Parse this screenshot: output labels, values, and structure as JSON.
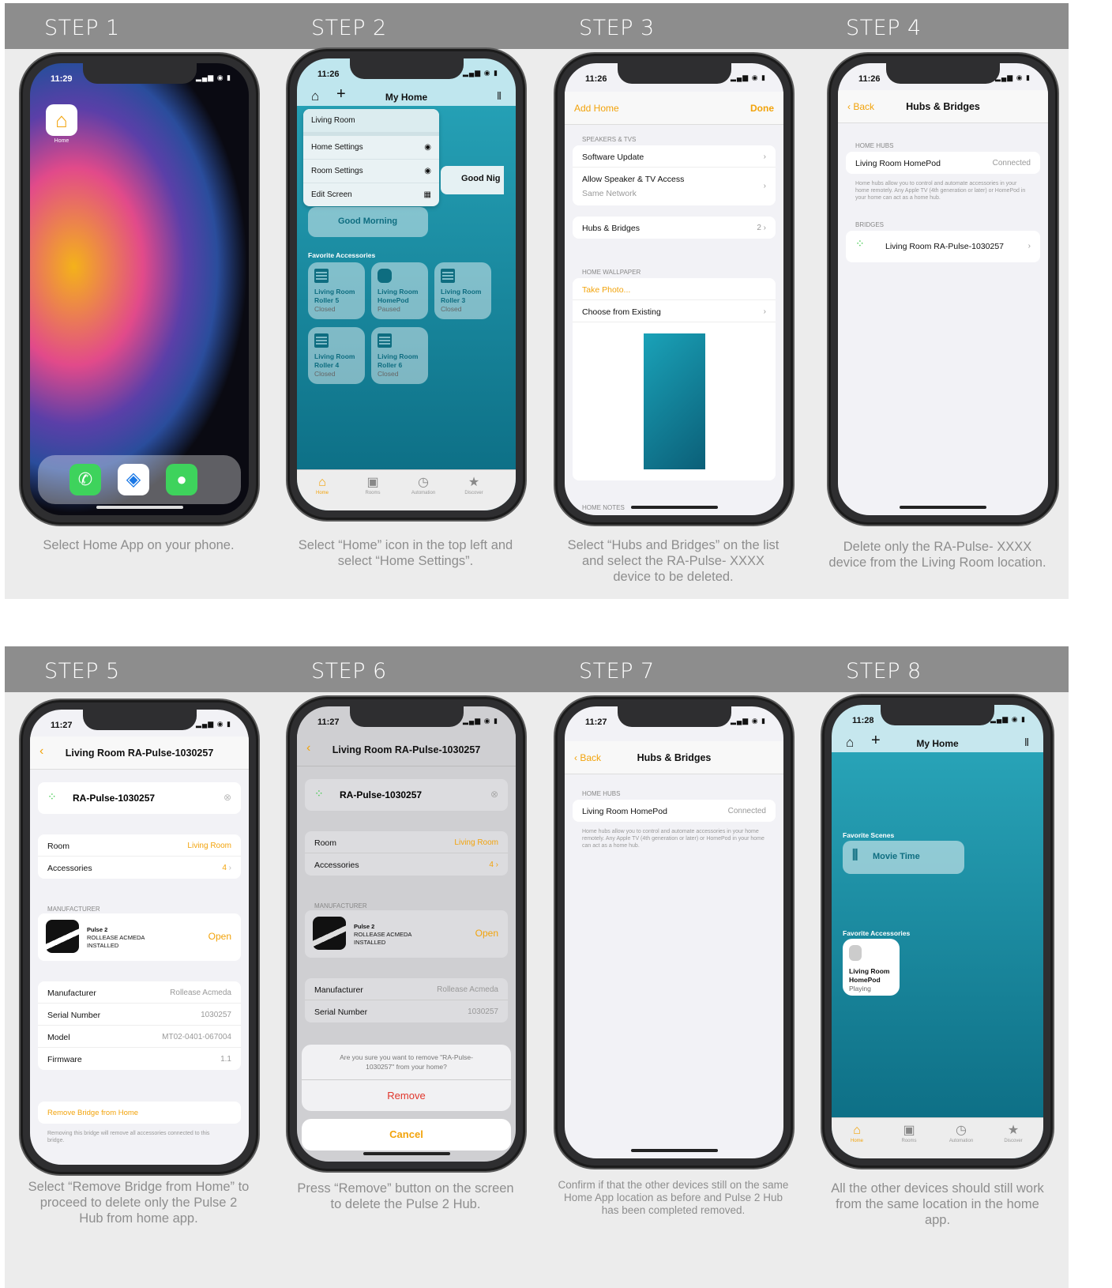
{
  "steps": [
    {
      "title": "STEP 1",
      "caption": "Select Home App on your phone."
    },
    {
      "title": "STEP 2",
      "caption": "Select “Home” icon in the top left and select “Home Settings”."
    },
    {
      "title": "STEP 3",
      "caption": "Select “Hubs and Bridges” on the list and select the RA-Pulse- XXXX device to be deleted."
    },
    {
      "title": "STEP 4",
      "caption": "Delete only the RA-Pulse- XXXX device from the Living Room location."
    },
    {
      "title": "STEP 5",
      "caption": "Select “Remove Bridge from Home” to proceed to delete only the Pulse 2 Hub from home app."
    },
    {
      "title": "STEP 6",
      "caption": "Press “Remove” button on the screen to delete the Pulse 2 Hub."
    },
    {
      "title": "STEP 7",
      "caption": "Confirm if that the other devices still on the same Home App location as before and Pulse 2 Hub has been completed removed."
    },
    {
      "title": "STEP 8",
      "caption": "All the other devices should still work from the same location in the home app."
    }
  ],
  "s1": {
    "time": "11:29",
    "app_label": "Home"
  },
  "s2": {
    "time": "11:26",
    "title": "My Home",
    "menu": [
      "Living Room",
      "Home Settings",
      "Room Settings",
      "Edit Screen"
    ],
    "scene1": "Good Morning",
    "scene2": "Good Nig",
    "fav": "Favorite Accessories",
    "tiles": [
      {
        "a": "Living Room",
        "b": "Roller 5",
        "c": "Closed"
      },
      {
        "a": "Living Room",
        "b": "HomePod",
        "c": "Paused"
      },
      {
        "a": "Living Room",
        "b": "Roller 3",
        "c": "Closed"
      },
      {
        "a": "Living Room",
        "b": "Roller 4",
        "c": "Closed"
      },
      {
        "a": "Living Room",
        "b": "Roller 6",
        "c": "Closed"
      }
    ],
    "tabs": [
      "Home",
      "Rooms",
      "Automation",
      "Discover"
    ]
  },
  "s3": {
    "time": "11:26",
    "left": "Add Home",
    "right": "Done",
    "sec1": "SPEAKERS & TVS",
    "r1": "Software Update",
    "r2": "Allow Speaker & TV Access",
    "r2v": "Same Network",
    "r3": "Hubs & Bridges",
    "r3v": "2",
    "sec2": "HOME WALLPAPER",
    "r4": "Take Photo...",
    "r5": "Choose from Existing",
    "sec3": "HOME NOTES"
  },
  "s4": {
    "time": "11:26",
    "back": "Back",
    "title": "Hubs & Bridges",
    "sec1": "HOME HUBS",
    "hub": "Living Room HomePod",
    "hubv": "Connected",
    "note": "Home hubs allow you to control and automate accessories in your home remotely. Any Apple TV (4th generation or later) or HomePod in your home can act as a home hub.",
    "sec2": "BRIDGES",
    "bridge": "Living Room RA-Pulse-1030257"
  },
  "s5": {
    "time": "11:27",
    "title": "Living Room RA-Pulse-1030257",
    "name": "RA-Pulse-1030257",
    "room": "Room",
    "roomv": "Living Room",
    "acc": "Accessories",
    "accv": "4",
    "msec": "MANUFACTURER",
    "p1": "Pulse 2",
    "p2": "ROLLEASE ACMEDA",
    "p3": "INSTALLED",
    "open": "Open",
    "m": "Manufacturer",
    "mv": "Rollease Acmeda",
    "sn": "Serial Number",
    "snv": "1030257",
    "mo": "Model",
    "mov": "MT02-0401-067004",
    "fw": "Firmware",
    "fwv": "1.1",
    "remove": "Remove Bridge from Home",
    "rnote": "Removing this bridge will remove all accessories connected to this bridge."
  },
  "s6": {
    "time": "11:27",
    "title": "Living Room RA-Pulse-1030257",
    "name": "RA-Pulse-1030257",
    "room": "Room",
    "roomv": "Living Room",
    "acc": "Accessories",
    "accv": "4",
    "msec": "MANUFACTURER",
    "p1": "Pulse 2",
    "p2": "ROLLEASE ACMEDA",
    "p3": "INSTALLED",
    "open": "Open",
    "m": "Manufacturer",
    "mv": "Rollease Acmeda",
    "sn": "Serial Number",
    "snv": "1030257",
    "alert": "Are you sure you want to remove \"RA-Pulse-1030257\" from your home?",
    "remove": "Remove",
    "cancel": "Cancel"
  },
  "s7": {
    "time": "11:27",
    "back": "Back",
    "title": "Hubs & Bridges",
    "sec1": "HOME HUBS",
    "hub": "Living Room HomePod",
    "hubv": "Connected",
    "note": "Home hubs allow you to control and automate accessories in your home remotely. Any Apple TV (4th generation or later) or HomePod in your home can act as a home hub."
  },
  "s8": {
    "time": "11:28",
    "title": "My Home",
    "scenes": "Favorite Scenes",
    "scene": "Movie Time",
    "fav": "Favorite Accessories",
    "t1": "Living Room",
    "t2": "HomePod",
    "t3": "Playing",
    "tabs": [
      "Home",
      "Rooms",
      "Automation",
      "Discover"
    ]
  }
}
